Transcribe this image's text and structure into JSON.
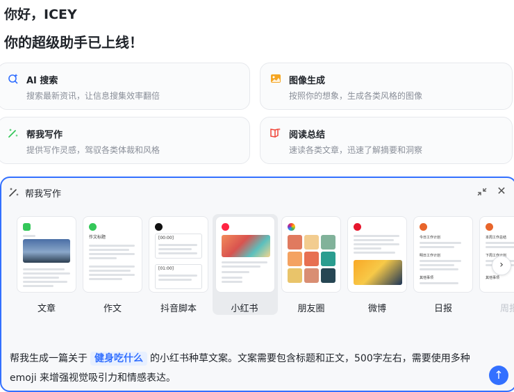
{
  "greeting": {
    "line1": "你好，ICEY",
    "line2": "你的超级助手已上线！"
  },
  "features": [
    {
      "title": "AI 搜索",
      "desc": "搜索最新资讯，让信息搜集效率翻倍",
      "icon": "search-sparkle-icon"
    },
    {
      "title": "图像生成",
      "desc": "按照你的想象，生成各类风格的图像",
      "icon": "image-icon"
    },
    {
      "title": "帮我写作",
      "desc": "提供写作灵感，驾驭各类体裁和风格",
      "icon": "pen-sparkle-icon"
    },
    {
      "title": "阅读总结",
      "desc": "速读各类文章，迅速了解摘要和洞察",
      "icon": "book-icon"
    }
  ],
  "panel": {
    "title": "帮我写作",
    "templates": [
      {
        "label": "文章"
      },
      {
        "label": "作文"
      },
      {
        "label": "抖音脚本"
      },
      {
        "label": "小红书"
      },
      {
        "label": "朋友圈"
      },
      {
        "label": "微博"
      },
      {
        "label": "日报"
      },
      {
        "label": "周报"
      }
    ],
    "selected_template": "小红书",
    "thumb_texts": {
      "essay_heading": "作文标题",
      "time1": "[00:00]",
      "time2": "[01:00]",
      "daily_today": "今日工作计划",
      "daily_tomorrow": "明日工作计划",
      "daily_other": "其他事项",
      "weekly_this": "本周工作总结",
      "weekly_next": "下周工作计划",
      "weekly_other": "其他事项"
    },
    "prompt": {
      "before": "帮我生成一篇关于",
      "keyword": "健身吃什么",
      "after": "的小红书种草文案。文案需要包含标题和正文，500字左右，需要使用多种 emoji 来增强视觉吸引力和情感表达。"
    }
  },
  "colors": {
    "accent": "#3370ff",
    "search": "#3370ff",
    "image": "#f5a623",
    "write": "#34c759",
    "read": "#f04438"
  }
}
